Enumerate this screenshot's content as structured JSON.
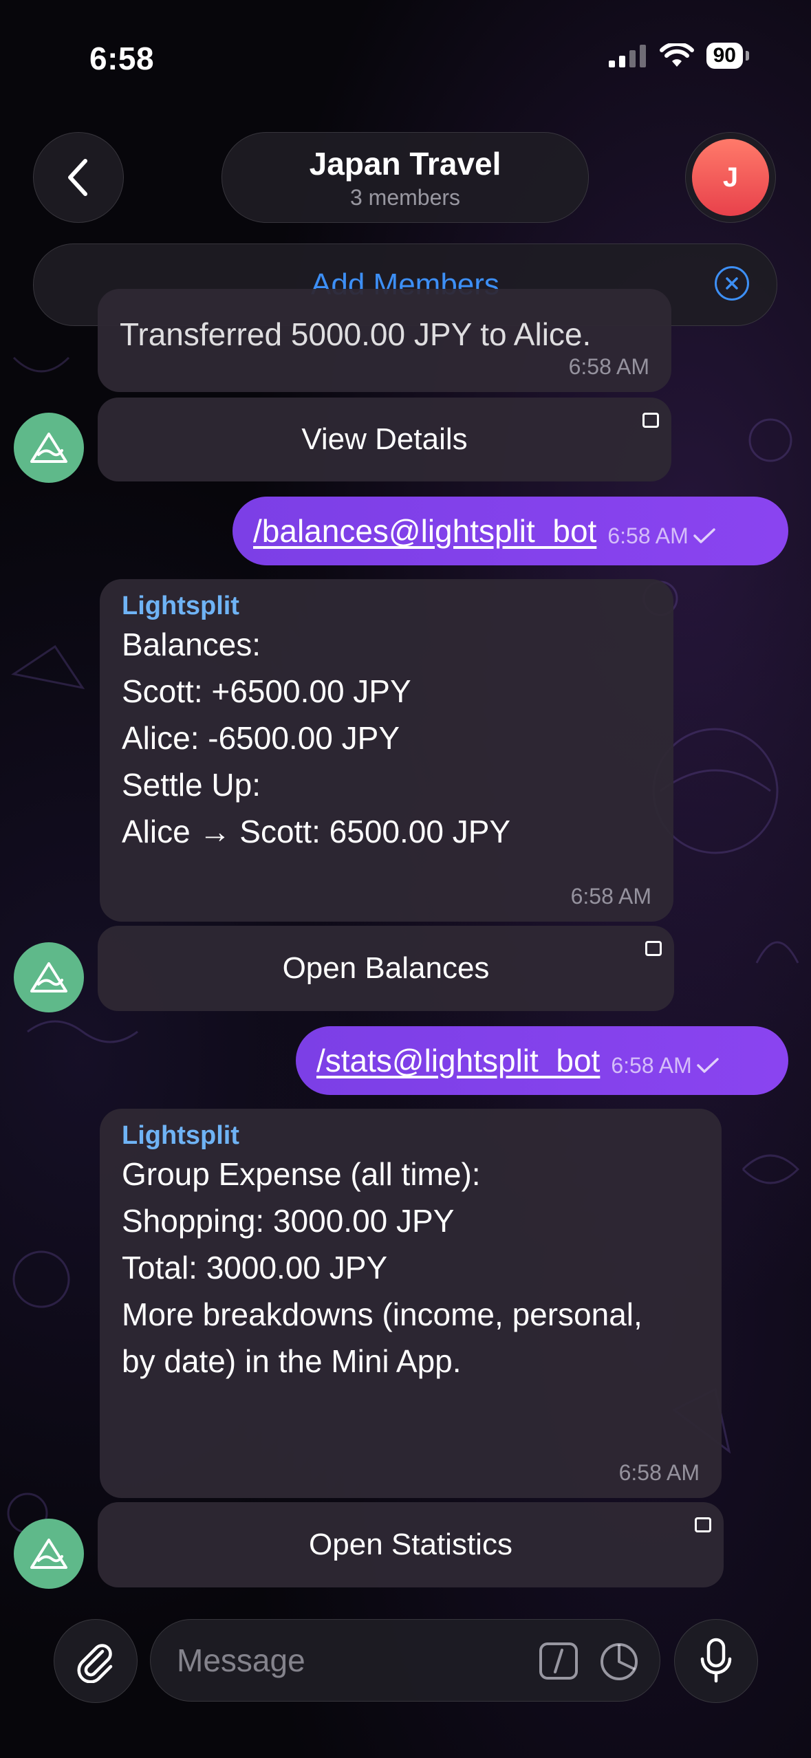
{
  "status_bar": {
    "time": "6:58",
    "battery": "90"
  },
  "header": {
    "title": "Japan Travel",
    "subtitle": "3 members",
    "avatar_initial": "J",
    "add_members_label": "Add Members"
  },
  "messages": {
    "m0": {
      "text": "Transferred 5000.00 JPY to Alice.",
      "time": "6:58 AM",
      "button": "View Details"
    },
    "m1": {
      "text": "/balances@lightsplit_bot",
      "time": "6:58 AM"
    },
    "m2": {
      "sender": "Lightsplit",
      "lines": [
        "Balances:",
        "Scott: +6500.00 JPY",
        "Alice: -6500.00 JPY",
        "",
        "Settle Up:",
        "Alice → Scott: 6500.00 JPY"
      ],
      "time": "6:58 AM",
      "button": "Open Balances"
    },
    "m3": {
      "text": "/stats@lightsplit_bot",
      "time": "6:58 AM"
    },
    "m4": {
      "sender": "Lightsplit",
      "lines": [
        "Group Expense (all time):",
        "Shopping: 3000.00 JPY",
        "",
        "Total: 3000.00 JPY",
        "",
        "More breakdowns (income, personal,",
        "by date) in the Mini App."
      ],
      "time": "6:58 AM",
      "button": "Open Statistics"
    }
  },
  "composer": {
    "placeholder": "Message"
  },
  "icons": {
    "back": "chevron-left-icon",
    "close": "close-circle-icon",
    "attach": "paperclip-icon",
    "command": "slash-command-icon",
    "sticker": "sticker-icon",
    "mic": "microphone-icon",
    "bot": "lightsplit-logo-icon"
  },
  "colors": {
    "accent_blue": "#3d8ff5",
    "outgoing_bubble": "#8a44f0",
    "sender_name": "#6fb3f5",
    "bot_avatar": "#5fb98a",
    "user_avatar": "#e8414b"
  }
}
